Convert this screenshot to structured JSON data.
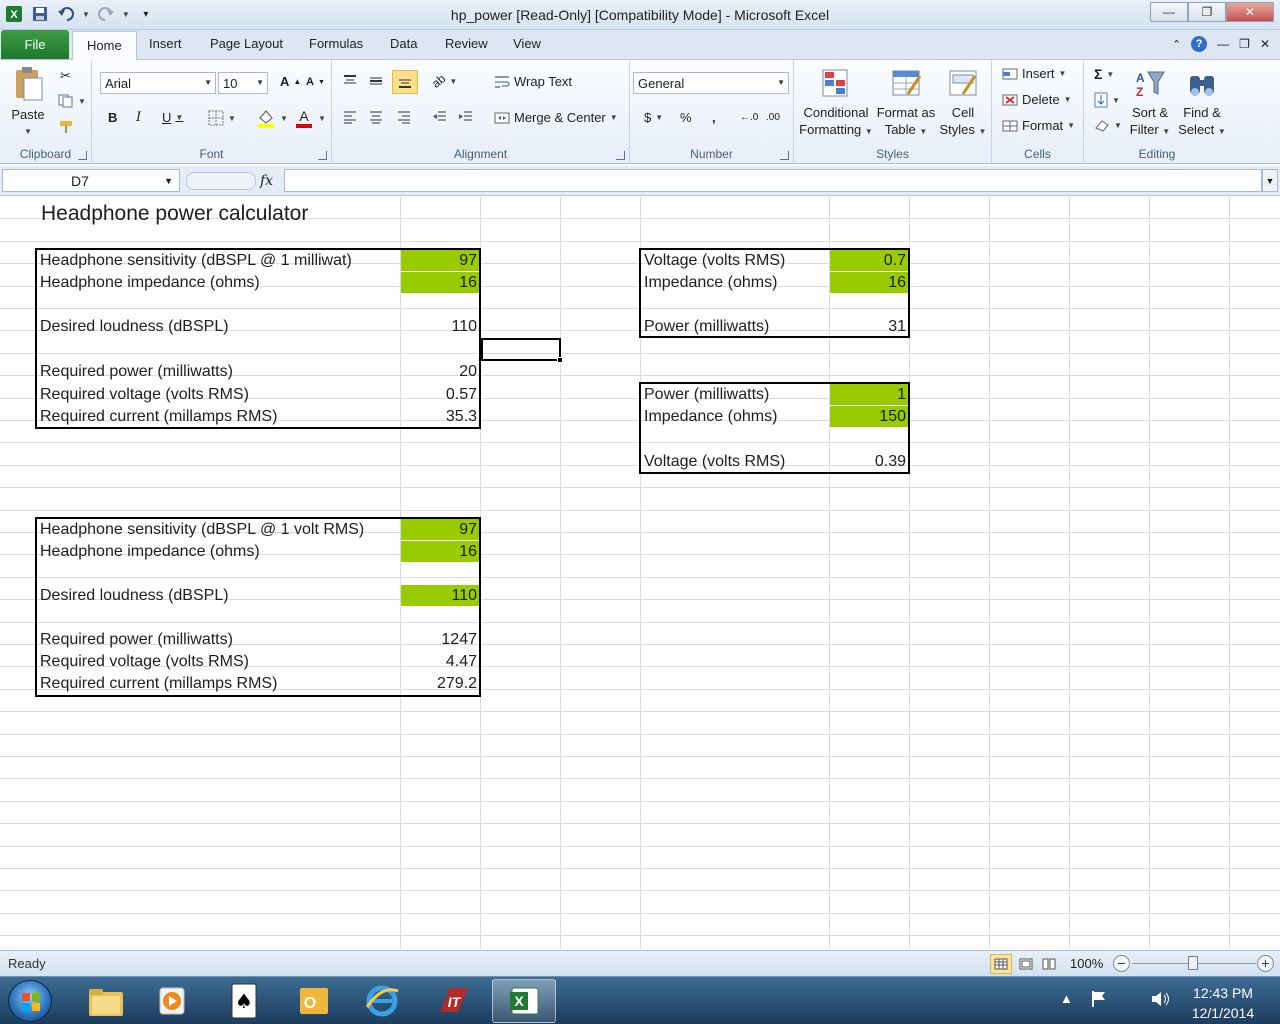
{
  "window": {
    "title": "hp_power  [Read-Only]  [Compatibility Mode] - Microsoft Excel",
    "minimize_glyph": "—",
    "restore_glyph": "❐",
    "close_glyph": "✕"
  },
  "tabs": {
    "file": "File",
    "home": "Home",
    "insert": "Insert",
    "page_layout": "Page Layout",
    "formulas": "Formulas",
    "data": "Data",
    "review": "Review",
    "view": "View"
  },
  "ribbon": {
    "clipboard": {
      "label": "Clipboard",
      "paste": "Paste"
    },
    "font": {
      "label": "Font",
      "name": "Arial",
      "size": "10"
    },
    "alignment": {
      "label": "Alignment",
      "wrap_text": "Wrap Text",
      "merge_center": "Merge & Center"
    },
    "number": {
      "label": "Number",
      "format": "General"
    },
    "styles": {
      "label": "Styles",
      "conditional_1": "Conditional",
      "conditional_2": "Formatting",
      "format_table_1": "Format as",
      "format_table_2": "Table",
      "cell_styles_1": "Cell",
      "cell_styles_2": "Styles"
    },
    "cells": {
      "label": "Cells",
      "insert": "Insert",
      "delete": "Delete",
      "format": "Format"
    },
    "editing": {
      "label": "Editing",
      "sort_1": "Sort &",
      "sort_2": "Filter",
      "find_1": "Find &",
      "find_2": "Select"
    }
  },
  "formula_bar": {
    "name_box": "D7",
    "fx": "fx",
    "formula": ""
  },
  "sheet": {
    "title": "Headphone power calculator",
    "table1": {
      "rows": [
        {
          "label": "Headphone sensitivity (dBSPL @ 1 milliwat)",
          "value": "97"
        },
        {
          "label": "Headphone impedance (ohms)",
          "value": "16"
        },
        {
          "label": "Desired loudness (dBSPL)",
          "value": "110"
        },
        {
          "label": "Required power (milliwatts)",
          "value": "20"
        },
        {
          "label": "Required voltage (volts RMS)",
          "value": "0.57"
        },
        {
          "label": "Required current (millamps RMS)",
          "value": "35.3"
        }
      ]
    },
    "table2": {
      "rows": [
        {
          "label": "Voltage (volts RMS)",
          "value": "0.7"
        },
        {
          "label": "Impedance (ohms)",
          "value": "16"
        },
        {
          "label": "Power (milliwatts)",
          "value": "31"
        }
      ]
    },
    "table3": {
      "rows": [
        {
          "label": "Power (milliwatts)",
          "value": "1"
        },
        {
          "label": "Impedance (ohms)",
          "value": "150"
        },
        {
          "label": "Voltage (volts RMS)",
          "value": "0.39"
        }
      ]
    },
    "table4": {
      "rows": [
        {
          "label": "Headphone sensitivity (dBSPL @ 1 volt RMS)",
          "value": "97"
        },
        {
          "label": "Headphone impedance (ohms)",
          "value": "16"
        },
        {
          "label": "Desired loudness (dBSPL)",
          "value": "110"
        },
        {
          "label": "Required power (milliwatts)",
          "value": "1247"
        },
        {
          "label": "Required voltage (volts RMS)",
          "value": "4.47"
        },
        {
          "label": "Required current (millamps RMS)",
          "value": "279.2"
        }
      ]
    },
    "input_color": "#99cc00"
  },
  "status": {
    "ready": "Ready",
    "zoom": "100%"
  },
  "taskbar": {
    "time": "12:43 PM",
    "date": "12/1/2014"
  }
}
